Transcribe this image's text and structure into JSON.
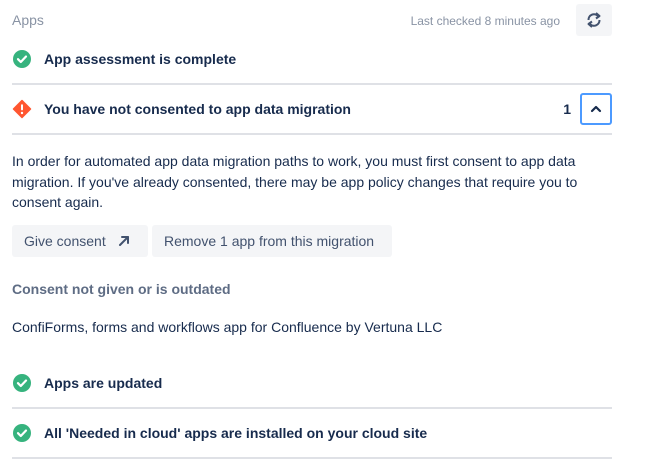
{
  "header": {
    "section_title": "Apps",
    "last_checked": "Last checked 8 minutes ago",
    "refresh_icon": "refresh-icon"
  },
  "checks": [
    {
      "title": "App assessment is complete",
      "status": "success",
      "icon": "check-circle-icon"
    },
    {
      "title": "You have not consented to app data migration",
      "status": "error",
      "icon": "warning-diamond-icon",
      "count": "1",
      "expanded": true
    },
    {
      "title": "Apps are updated",
      "status": "success",
      "icon": "check-circle-icon"
    },
    {
      "title": "All 'Needed in cloud' apps are installed on your cloud site",
      "status": "success",
      "icon": "check-circle-icon"
    }
  ],
  "consent_detail": {
    "description": "In order for automated app data migration paths to work, you must first consent to app data migration. If you've already consented, there may be app policy changes that require you to consent again.",
    "give_consent_label": "Give consent",
    "remove_label": "Remove 1 app from this migration",
    "status_label": "Consent not given or is outdated",
    "app_name": "ConfiForms, forms and workflows app for Confluence by Vertuna LLC"
  },
  "colors": {
    "success": "#36B37E",
    "error": "#FF5630",
    "focus": "#4C9AFF",
    "text": "#172B4D",
    "muted": "#8993A4"
  }
}
